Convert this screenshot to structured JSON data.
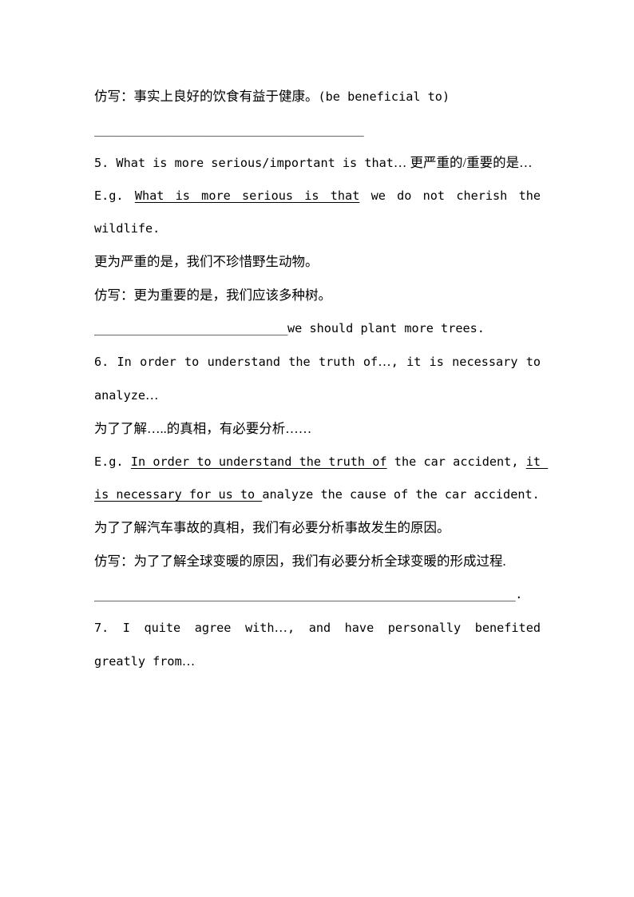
{
  "document": {
    "page_background": "#ffffff",
    "text_color": "#000000",
    "lines": [
      {
        "id": "imitate-4",
        "kind": "mixed",
        "segments": [
          {
            "style": "cn",
            "text": "仿写：事实上良好的饮食有益于健康。"
          },
          {
            "style": "en",
            "text": "(be beneficial to)"
          }
        ]
      },
      {
        "id": "blank-4",
        "kind": "blank",
        "text": "_______________________________________"
      },
      {
        "id": "item-5-heading",
        "kind": "mixed",
        "segments": [
          {
            "style": "en",
            "text": "5. What is more serious/important is that"
          },
          {
            "style": "cn",
            "text": "… 更严重的/重要的是…"
          }
        ]
      },
      {
        "id": "item-5-eg",
        "kind": "mixed",
        "segments": [
          {
            "style": "en",
            "text": "E.g. "
          },
          {
            "style": "en-underline",
            "text": "What is more serious is that"
          },
          {
            "style": "en",
            "text": " we do not cherish the wildlife."
          }
        ]
      },
      {
        "id": "item-5-translation",
        "kind": "cn",
        "text": "更为严重的是，我们不珍惜野生动物。"
      },
      {
        "id": "item-5-imitate",
        "kind": "cn",
        "text": "仿写：更为重要的是，我们应该多种树。"
      },
      {
        "id": "item-5-answer-blank",
        "kind": "mixed",
        "segments": [
          {
            "style": "blank",
            "text": "____________________________"
          },
          {
            "style": "en",
            "text": "we should plant more trees."
          }
        ]
      },
      {
        "id": "item-6-heading",
        "kind": "mixed",
        "segments": [
          {
            "style": "en",
            "text": "6. In order to understand the truth of"
          },
          {
            "style": "cn",
            "text": "…"
          },
          {
            "style": "en",
            "text": ", it is necessary to analyze"
          },
          {
            "style": "cn",
            "text": "…"
          }
        ]
      },
      {
        "id": "item-6-translation-template",
        "kind": "cn",
        "text": "为了了解…..的真相，有必要分析……"
      },
      {
        "id": "item-6-eg",
        "kind": "mixed",
        "segments": [
          {
            "style": "en",
            "text": "E.g. "
          },
          {
            "style": "en-underline",
            "text": "In order to understand the truth of"
          },
          {
            "style": "en",
            "text": " the car accident, "
          },
          {
            "style": "en-underline",
            "text": "it is necessary for us to "
          },
          {
            "style": "en",
            "text": "analyze the cause of the car accident."
          }
        ]
      },
      {
        "id": "item-6-translation",
        "kind": "cn",
        "text": "为了了解汽车事故的真相，我们有必要分析事故发生的原因。"
      },
      {
        "id": "item-6-imitate",
        "kind": "cn",
        "text": "仿写：为了了解全球变暖的原因，我们有必要分析全球变暖的形成过程."
      },
      {
        "id": "item-6-answer-blank",
        "kind": "blank",
        "text": "_____________________________________________________________."
      },
      {
        "id": "item-7-heading",
        "kind": "mixed",
        "segments": [
          {
            "style": "en",
            "text": "7. I quite agree with"
          },
          {
            "style": "cn",
            "text": "…"
          },
          {
            "style": "en",
            "text": ", and have personally benefited greatly from"
          },
          {
            "style": "cn",
            "text": "…"
          }
        ]
      }
    ],
    "text_values": {
      "imitate_4_cn": "仿写：事实上良好的饮食有益于健康。",
      "imitate_4_en": "(be beneficial to)",
      "blank_4": "_______________________________________",
      "item5_en": "5. What is more serious/important is that",
      "item5_cn": "… 更严重的/重要的是…",
      "item5_eg_label": "E.g. ",
      "item5_eg_underlined": "What is more serious is that",
      "item5_eg_rest": " we do not cherish the wildlife.",
      "item5_translation": "更为严重的是，我们不珍惜野生动物。",
      "item5_imitate": "仿写：更为重要的是，我们应该多种树。",
      "item5_blank": "____________________________",
      "item5_blank_tail": "we should plant more trees.",
      "item6_en_a": "6. In order to understand the truth of",
      "item6_cn_a": "…",
      "item6_en_b": ", it is necessary to analyze",
      "item6_cn_b": "…",
      "item6_template_cn": "为了了解…..的真相，有必要分析……",
      "item6_eg_label": "E.g. ",
      "item6_eg_underline_1": "In order to understand the truth of",
      "item6_eg_mid": " the car accident, ",
      "item6_eg_underline_2": "it is necessary for us to ",
      "item6_eg_rest": "analyze the cause of the car accident.",
      "item6_translation": "为了了解汽车事故的真相，我们有必要分析事故发生的原因。",
      "item6_imitate": "仿写：为了了解全球变暖的原因，我们有必要分析全球变暖的形成过程.",
      "item6_blank": "_____________________________________________________________.",
      "item7_en_a": "7. I quite agree with",
      "item7_cn_a": "…",
      "item7_en_b": ", and have personally benefited greatly from",
      "item7_cn_b": "…"
    }
  }
}
